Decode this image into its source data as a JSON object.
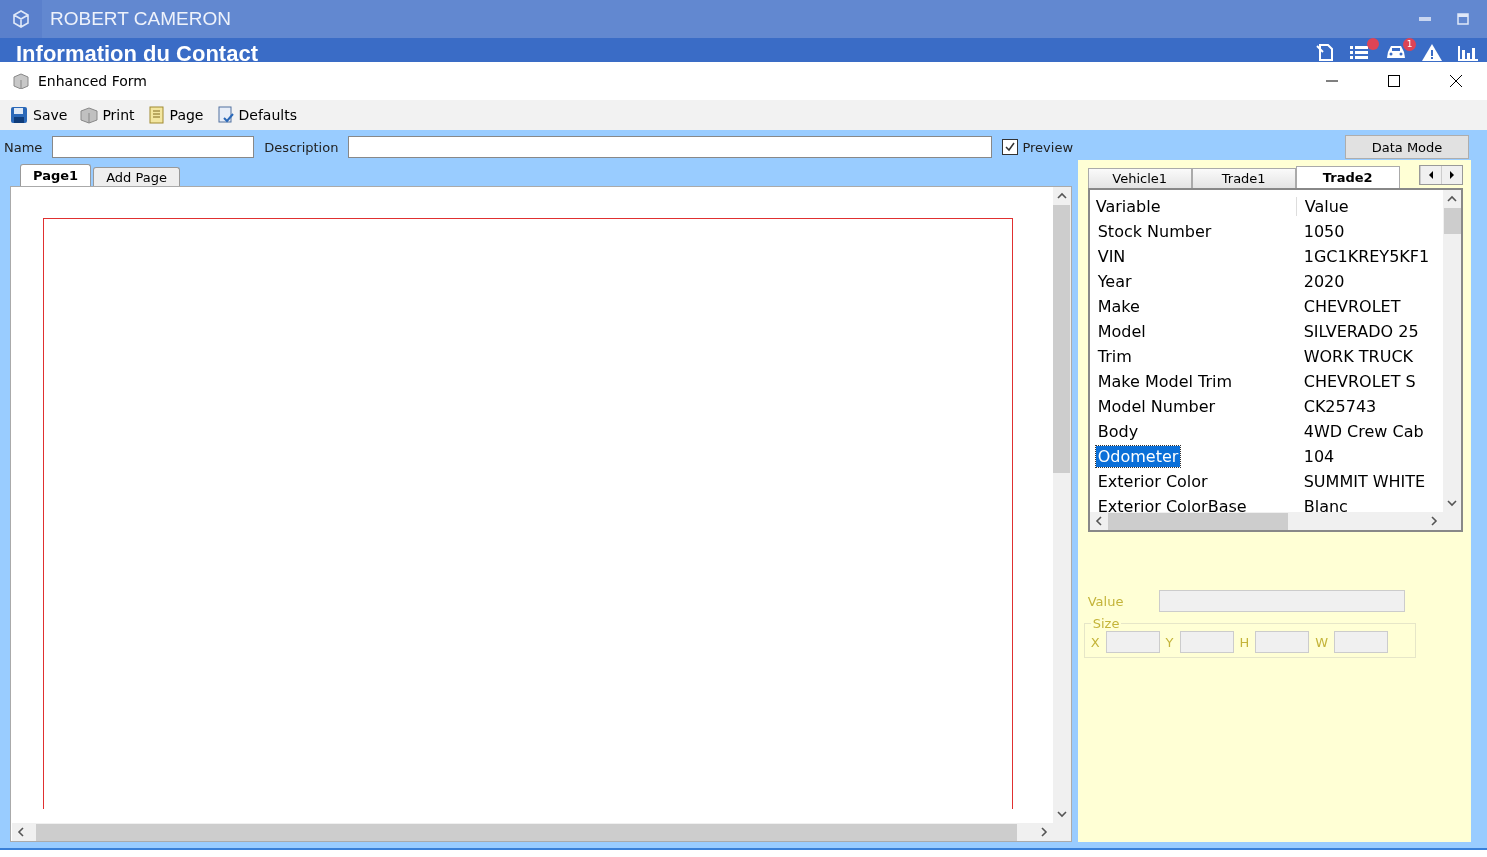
{
  "app": {
    "title": "ROBERT CAMERON",
    "subtitle": "Information du Contact",
    "alert_dot": true,
    "vehicle_badge": "1"
  },
  "dialog": {
    "title": "Enhanced Form"
  },
  "toolbar": [
    {
      "label": "Save"
    },
    {
      "label": "Print"
    },
    {
      "label": "Page"
    },
    {
      "label": "Defaults"
    }
  ],
  "form": {
    "name_label": "Name",
    "description_label": "Description",
    "preview": {
      "label": "Preview",
      "checked": true
    },
    "data_mode_button": "Data Mode"
  },
  "page_tabs": [
    {
      "label": "Page1",
      "selected": true
    },
    {
      "label": "Add Page",
      "selected": false
    }
  ],
  "data_tabs": [
    {
      "label": "Vehicle1",
      "selected": false
    },
    {
      "label": "Trade1",
      "selected": false
    },
    {
      "label": "Trade2",
      "selected": true
    }
  ],
  "grid": {
    "columns": [
      "Variable",
      "Value"
    ],
    "rows": [
      {
        "variable": "Stock Number",
        "value": "1050",
        "selected": false
      },
      {
        "variable": "VIN",
        "value": "1GC1KREY5KF1",
        "selected": false
      },
      {
        "variable": "Year",
        "value": "2020",
        "selected": false
      },
      {
        "variable": "Make",
        "value": "CHEVROLET",
        "selected": false
      },
      {
        "variable": "Model",
        "value": "SILVERADO 25",
        "selected": false
      },
      {
        "variable": "Trim",
        "value": "WORK TRUCK",
        "selected": false
      },
      {
        "variable": "Make Model Trim",
        "value": "CHEVROLET S",
        "selected": false
      },
      {
        "variable": "Model Number",
        "value": "CK25743",
        "selected": false
      },
      {
        "variable": "Body",
        "value": "4WD Crew Cab",
        "selected": false
      },
      {
        "variable": "Odometer",
        "value": "104",
        "selected": true
      },
      {
        "variable": "Exterior Color",
        "value": "SUMMIT WHITE",
        "selected": false
      },
      {
        "variable": "Exterior ColorBase",
        "value": "Blanc",
        "selected": false
      }
    ]
  },
  "properties": {
    "value_label": "Value",
    "size_label": "Size",
    "coords": [
      "X",
      "Y",
      "H",
      "W"
    ]
  }
}
